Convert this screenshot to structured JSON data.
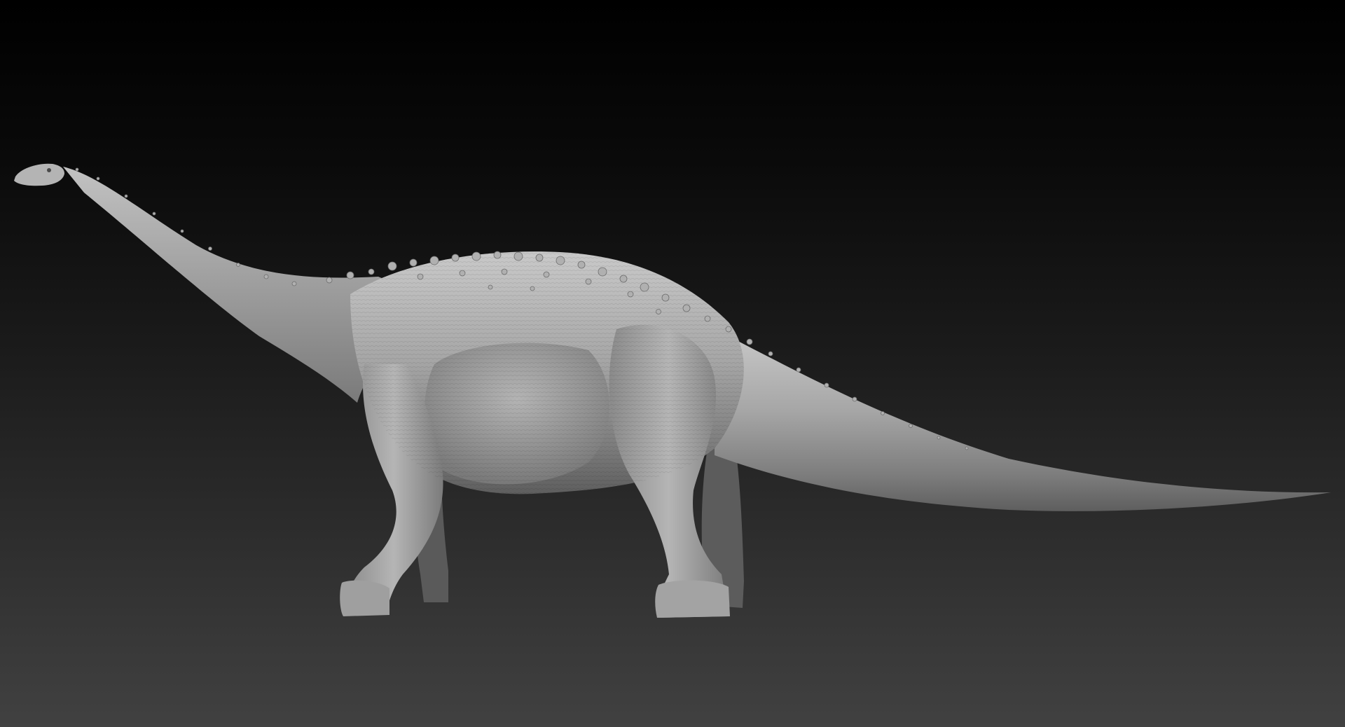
{
  "scene": {
    "subject": "sauropod-sculpt",
    "material": "matte-grey-clay",
    "background_colors": {
      "top": "#000000",
      "bottom": "#414141"
    },
    "model_colors": {
      "highlight": "#c9c9c9",
      "base": "#9a9a9a",
      "shadow": "#5e5e5e",
      "deep_shadow": "#3c3c3c"
    }
  }
}
